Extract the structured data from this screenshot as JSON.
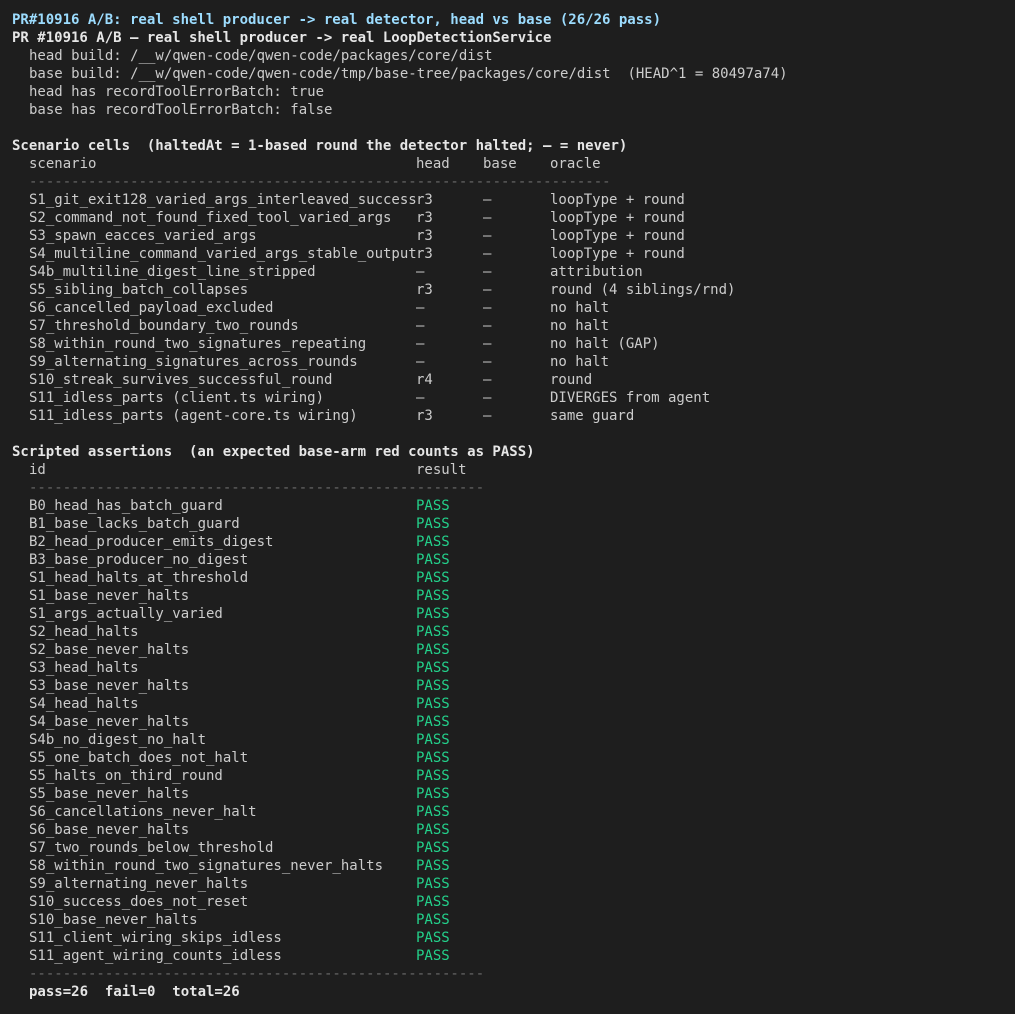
{
  "header": {
    "title": "PR#10916 A/B: real shell producer -> real detector, head vs base (26/26 pass)",
    "subtitle": "PR #10916 A/B — real shell producer -> real LoopDetectionService",
    "info": [
      "head build: /__w/qwen-code/qwen-code/packages/core/dist",
      "base build: /__w/qwen-code/qwen-code/tmp/base-tree/packages/core/dist  (HEAD^1 = 80497a74)",
      "head has recordToolErrorBatch: true",
      "base has recordToolErrorBatch: false"
    ]
  },
  "scenarios": {
    "heading": "Scenario cells  (haltedAt = 1-based round the detector halted; — = never)",
    "columns": {
      "scenario": "scenario",
      "head": "head",
      "base": "base",
      "oracle": "oracle"
    },
    "separator": "---------------------------------------------------------------------",
    "rows": [
      {
        "scenario": "S1_git_exit128_varied_args_interleaved_success",
        "head": "r3",
        "base": "—",
        "oracle": "loopType + round"
      },
      {
        "scenario": "S2_command_not_found_fixed_tool_varied_args",
        "head": "r3",
        "base": "—",
        "oracle": "loopType + round"
      },
      {
        "scenario": "S3_spawn_eacces_varied_args",
        "head": "r3",
        "base": "—",
        "oracle": "loopType + round"
      },
      {
        "scenario": "S4_multiline_command_varied_args_stable_output",
        "head": "r3",
        "base": "—",
        "oracle": "loopType + round"
      },
      {
        "scenario": "S4b_multiline_digest_line_stripped",
        "head": "—",
        "base": "—",
        "oracle": "attribution"
      },
      {
        "scenario": "S5_sibling_batch_collapses",
        "head": "r3",
        "base": "—",
        "oracle": "round (4 siblings/rnd)"
      },
      {
        "scenario": "S6_cancelled_payload_excluded",
        "head": "—",
        "base": "—",
        "oracle": "no halt"
      },
      {
        "scenario": "S7_threshold_boundary_two_rounds",
        "head": "—",
        "base": "—",
        "oracle": "no halt"
      },
      {
        "scenario": "S8_within_round_two_signatures_repeating",
        "head": "—",
        "base": "—",
        "oracle": "no halt (GAP)"
      },
      {
        "scenario": "S9_alternating_signatures_across_rounds",
        "head": "—",
        "base": "—",
        "oracle": "no halt"
      },
      {
        "scenario": "S10_streak_survives_successful_round",
        "head": "r4",
        "base": "—",
        "oracle": "round"
      },
      {
        "scenario": "S11_idless_parts (client.ts wiring)",
        "head": "—",
        "base": "—",
        "oracle": "DIVERGES from agent"
      },
      {
        "scenario": "S11_idless_parts (agent-core.ts wiring)",
        "head": "r3",
        "base": "—",
        "oracle": "same guard"
      }
    ]
  },
  "assertions": {
    "heading": "Scripted assertions  (an expected base-arm red counts as PASS)",
    "columns": {
      "id": "id",
      "result": "result"
    },
    "separator": "------------------------------------------------------",
    "rows": [
      {
        "id": "B0_head_has_batch_guard",
        "result": "PASS"
      },
      {
        "id": "B1_base_lacks_batch_guard",
        "result": "PASS"
      },
      {
        "id": "B2_head_producer_emits_digest",
        "result": "PASS"
      },
      {
        "id": "B3_base_producer_no_digest",
        "result": "PASS"
      },
      {
        "id": "S1_head_halts_at_threshold",
        "result": "PASS"
      },
      {
        "id": "S1_base_never_halts",
        "result": "PASS"
      },
      {
        "id": "S1_args_actually_varied",
        "result": "PASS"
      },
      {
        "id": "S2_head_halts",
        "result": "PASS"
      },
      {
        "id": "S2_base_never_halts",
        "result": "PASS"
      },
      {
        "id": "S3_head_halts",
        "result": "PASS"
      },
      {
        "id": "S3_base_never_halts",
        "result": "PASS"
      },
      {
        "id": "S4_head_halts",
        "result": "PASS"
      },
      {
        "id": "S4_base_never_halts",
        "result": "PASS"
      },
      {
        "id": "S4b_no_digest_no_halt",
        "result": "PASS"
      },
      {
        "id": "S5_one_batch_does_not_halt",
        "result": "PASS"
      },
      {
        "id": "S5_halts_on_third_round",
        "result": "PASS"
      },
      {
        "id": "S5_base_never_halts",
        "result": "PASS"
      },
      {
        "id": "S6_cancellations_never_halt",
        "result": "PASS"
      },
      {
        "id": "S6_base_never_halts",
        "result": "PASS"
      },
      {
        "id": "S7_two_rounds_below_threshold",
        "result": "PASS"
      },
      {
        "id": "S8_within_round_two_signatures_never_halts",
        "result": "PASS"
      },
      {
        "id": "S9_alternating_never_halts",
        "result": "PASS"
      },
      {
        "id": "S10_success_does_not_reset",
        "result": "PASS"
      },
      {
        "id": "S10_base_never_halts",
        "result": "PASS"
      },
      {
        "id": "S11_client_wiring_skips_idless",
        "result": "PASS"
      },
      {
        "id": "S11_agent_wiring_counts_idless",
        "result": "PASS"
      }
    ],
    "footer_separator": "------------------------------------------------------",
    "summary": "pass=26  fail=0  total=26"
  },
  "colors": {
    "background": "#1e1e1e",
    "title": "#9cdcfe",
    "pass": "#23d18b",
    "separator": "#6b6b6b"
  }
}
